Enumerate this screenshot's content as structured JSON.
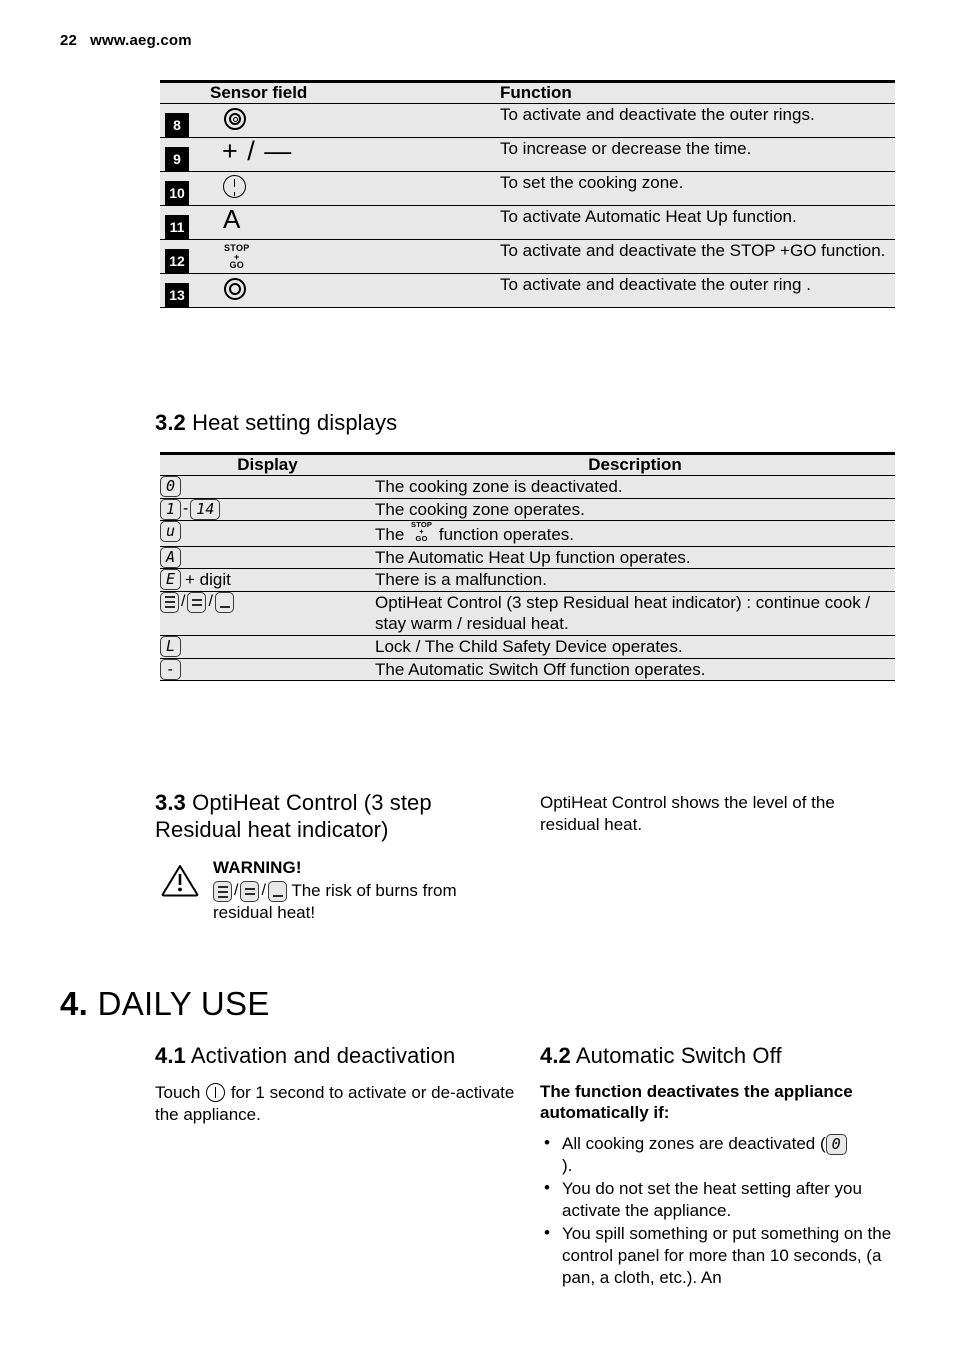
{
  "header": {
    "page_number": "22",
    "site": "www.aeg.com"
  },
  "table_sensor": {
    "columns": [
      "",
      "Sensor field",
      "Function"
    ],
    "rows": [
      {
        "num": "8",
        "icon": "triple-ring-icon",
        "function": "To activate and deactivate the outer rings."
      },
      {
        "num": "9",
        "icon": "plus-minus-icon",
        "function": "To increase or decrease the time."
      },
      {
        "num": "10",
        "icon": "clock-icon",
        "function": "To set the cooking zone."
      },
      {
        "num": "11",
        "icon": "letter-a-icon",
        "function": "To activate Automatic Heat Up function."
      },
      {
        "num": "12",
        "icon": "stop-go-icon",
        "function": "To activate and deactivate the STOP +GO function."
      },
      {
        "num": "13",
        "icon": "double-ring-icon",
        "function": "To activate and deactivate the outer ring ."
      }
    ],
    "stop_go": {
      "line1": "STOP",
      "line2": "+",
      "line3": "GO"
    },
    "letter_a": "A",
    "plus_minus": "+ / —"
  },
  "section_3_2": {
    "number": "3.2",
    "title": "Heat setting displays",
    "columns": [
      "Display",
      "Description"
    ],
    "rows": [
      {
        "display": "0",
        "description": "The cooking zone is deactivated."
      },
      {
        "display": "1 - 14",
        "description": "The cooking zone operates."
      },
      {
        "display": "u",
        "description": "The  function operates.",
        "desc_pre": "The",
        "desc_post": "function operates."
      },
      {
        "display": "A",
        "description": "The Automatic Heat Up function operates."
      },
      {
        "display": "E + digit",
        "description": "There is a malfunction."
      },
      {
        "display": "bars-3/2/1",
        "description": "OptiHeat Control (3 step Residual heat indicator) : continue cook / stay warm / residual heat."
      },
      {
        "display": "L",
        "description": "Lock / The Child Safety Device operates."
      },
      {
        "display": "-",
        "description": "The Automatic Switch Off function operates."
      }
    ],
    "chips": {
      "zero": "0",
      "one": "1",
      "fourteen": "14",
      "u": "u",
      "a": "A",
      "e": "E",
      "l": "L",
      "dash": "-",
      "plus_digit": "+ digit",
      "range_sep": "-"
    }
  },
  "section_3_3": {
    "number": "3.3",
    "title": "OptiHeat Control (3 step Residual heat indicator)",
    "side_text": "OptiHeat Control shows the level of the residual heat.",
    "warning": {
      "icon": "warning-triangle-icon",
      "title": "WARNING!",
      "text": "The risk of burns from residual heat!"
    }
  },
  "section_4": {
    "number": "4.",
    "title": "DAILY USE"
  },
  "section_4_1": {
    "number": "4.1",
    "title": "Activation and deactivation",
    "text_pre": "Touch",
    "icon": "power-icon",
    "text_post": "for 1 second to activate or de-activate the appliance."
  },
  "section_4_2": {
    "number": "4.2",
    "title": "Automatic Switch Off",
    "lead": "The function deactivates the appliance automatically if:",
    "bullets": [
      "All cooking zones are deactivated (",
      "You do not set the heat setting after you activate the appliance.",
      "You spill something or put something on the control panel for more than 10 seconds, (a pan, a cloth, etc.). An"
    ],
    "bullet1_tail": ")."
  },
  "colors": {
    "table_bg": "#e8e8e8",
    "rule": "#000000",
    "badge_bg": "#000000",
    "badge_text": "#ffffff",
    "page_bg": "#ffffff"
  }
}
